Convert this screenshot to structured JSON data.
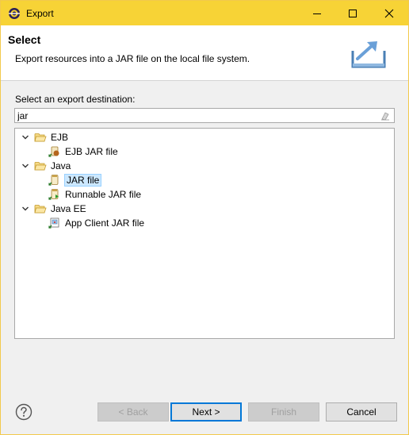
{
  "window": {
    "title": "Export"
  },
  "banner": {
    "title": "Select",
    "description": "Export resources into a JAR file on the local file system."
  },
  "destination": {
    "label": "Select an export destination:",
    "filter_value": "jar"
  },
  "tree": {
    "items": [
      {
        "label": "EJB",
        "type": "folder",
        "expanded": true
      },
      {
        "label": "EJB JAR file",
        "type": "wizard"
      },
      {
        "label": "Java",
        "type": "folder",
        "expanded": true
      },
      {
        "label": "JAR file",
        "type": "wizard",
        "selected": true
      },
      {
        "label": "Runnable JAR file",
        "type": "wizard"
      },
      {
        "label": "Java EE",
        "type": "folder",
        "expanded": true
      },
      {
        "label": "App Client JAR file",
        "type": "wizard"
      }
    ]
  },
  "footer": {
    "back_label": "< Back",
    "next_label": "Next >",
    "finish_label": "Finish",
    "cancel_label": "Cancel"
  },
  "colors": {
    "titlebar": "#f7d336",
    "selection": "#cce8ff",
    "primary_border": "#0078d7"
  }
}
